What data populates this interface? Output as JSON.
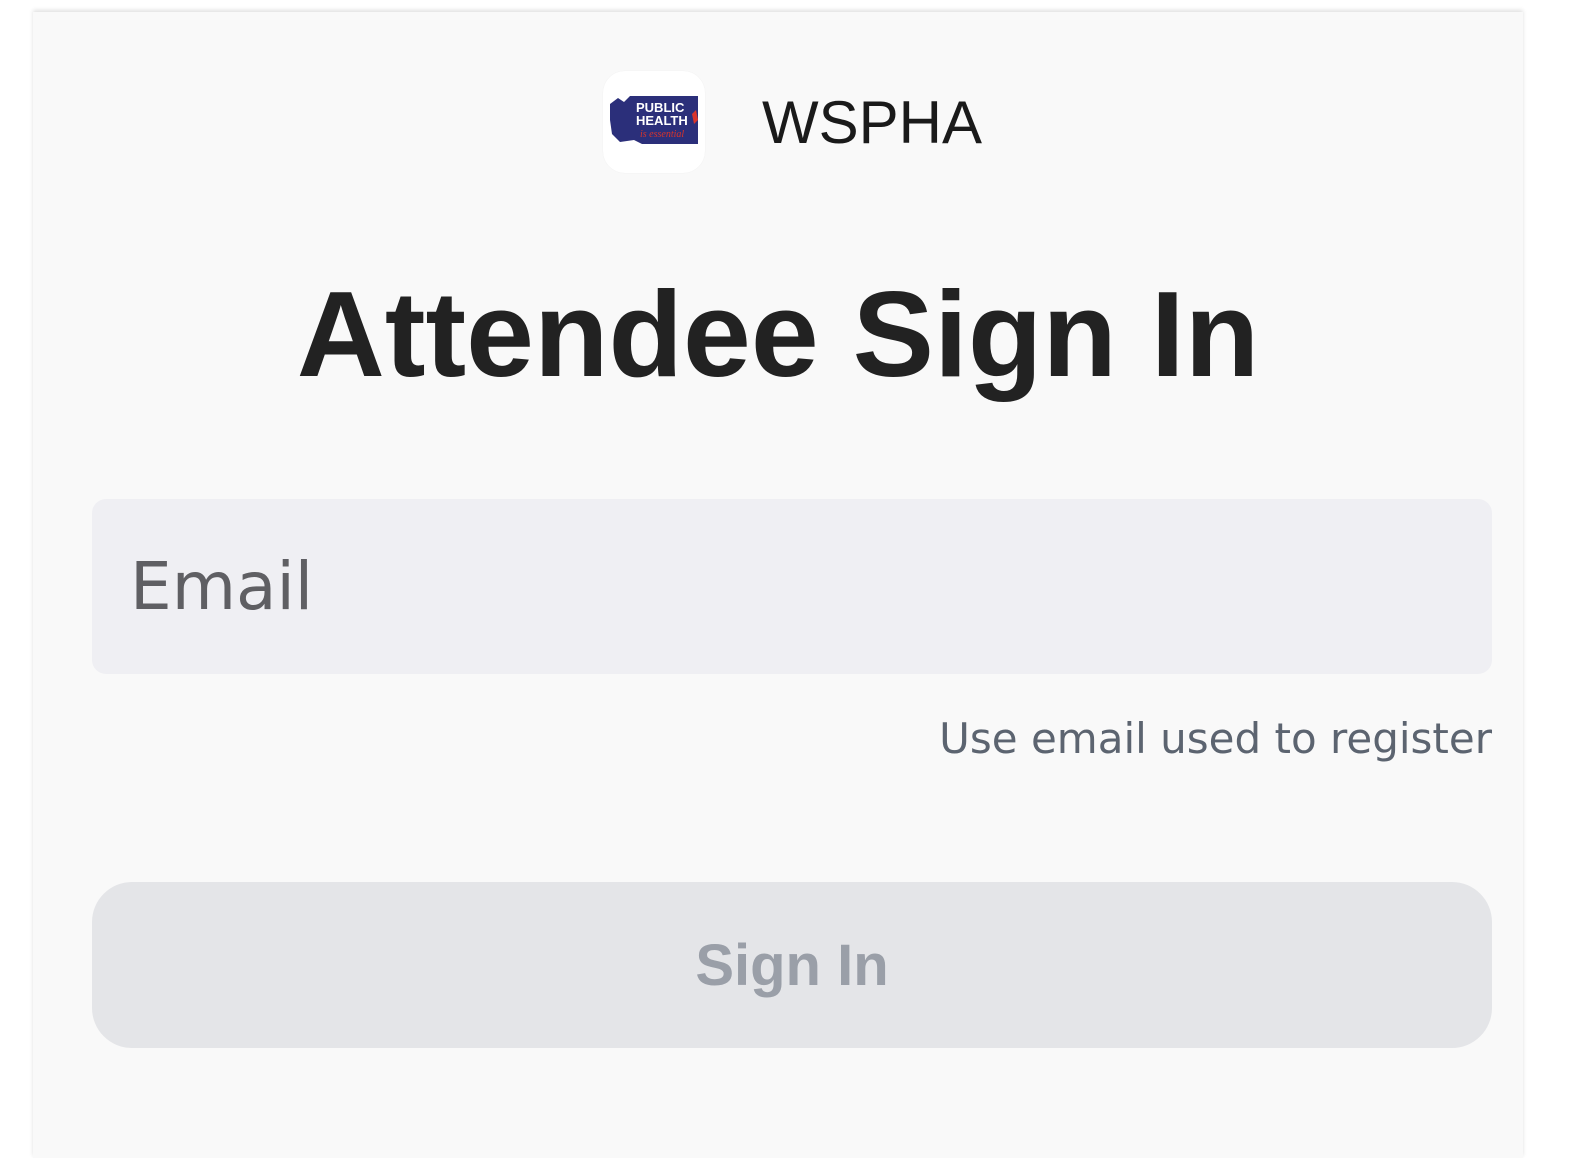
{
  "header": {
    "logo_text": "PUBLIC HEALTH is essential",
    "org_name": "WSPHA"
  },
  "page": {
    "title": "Attendee Sign In"
  },
  "form": {
    "email_placeholder": "Email",
    "email_value": "",
    "hint": "Use email used to register",
    "submit_label": "Sign In"
  },
  "colors": {
    "logo_navy": "#2b2f7a",
    "logo_red": "#d9342b"
  }
}
